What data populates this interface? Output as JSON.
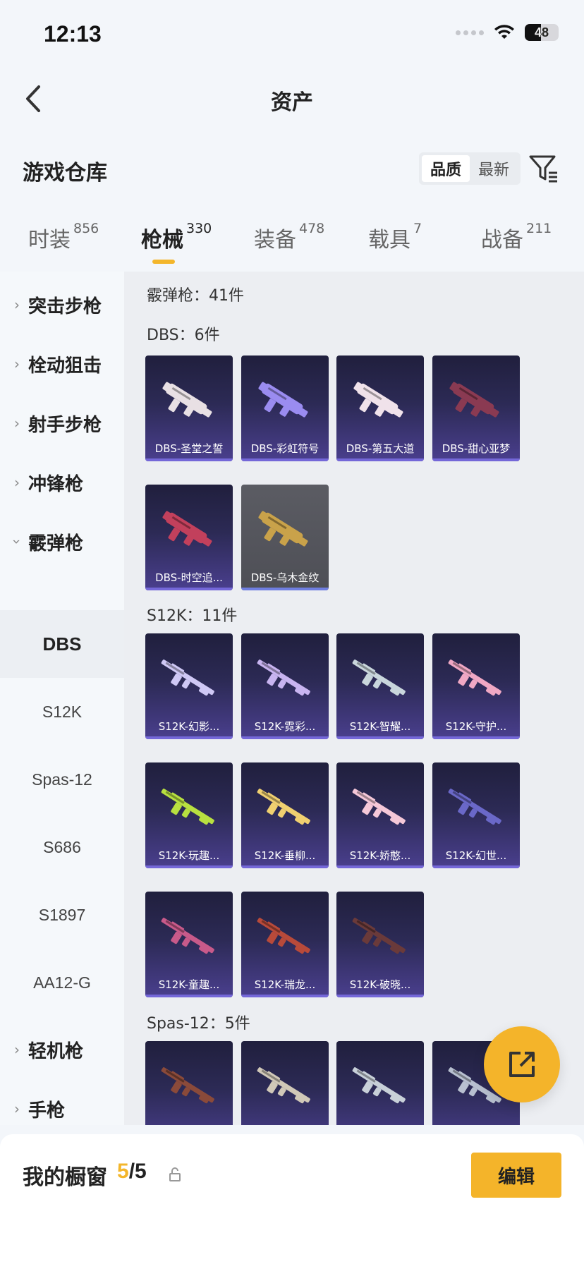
{
  "status": {
    "time": "12:13",
    "battery": "48",
    "battery_level": 0.48
  },
  "nav": {
    "title": "资产"
  },
  "warehouse": {
    "title": "游戏仓库",
    "sort_options": [
      "品质",
      "最新"
    ],
    "sort_active": "品质"
  },
  "tabs": [
    {
      "label": "时装",
      "count": "856"
    },
    {
      "label": "枪械",
      "count": "330"
    },
    {
      "label": "装备",
      "count": "478"
    },
    {
      "label": "载具",
      "count": "7"
    },
    {
      "label": "战备",
      "count": "211"
    }
  ],
  "sidebar": {
    "categories": [
      "突击步枪",
      "栓动狙击",
      "射手步枪",
      "冲锋枪",
      "霰弹枪"
    ],
    "subs": [
      "DBS",
      "S12K",
      "Spas-12",
      "S686",
      "S1897",
      "AA12-G"
    ],
    "bottom_categories": [
      "轻机枪",
      "手枪"
    ]
  },
  "content": {
    "category_title": "霰弹枪：41件",
    "groups": [
      {
        "title": "DBS：6件",
        "items": [
          "DBS-圣堂之誓",
          "DBS-彩虹符号",
          "DBS-第五大道",
          "DBS-甜心亚梦",
          "DBS-时空追...",
          "DBS-乌木金纹"
        ]
      },
      {
        "title": "S12K：11件",
        "items": [
          "S12K-幻影...",
          "S12K-霓彩...",
          "S12K-智耀...",
          "S12K-守护...",
          "S12K-玩趣...",
          "S12K-垂柳...",
          "S12K-娇憨...",
          "S12K-幻世...",
          "S12K-童趣...",
          "S12K-瑞龙...",
          "S12K-破晓..."
        ]
      },
      {
        "title": "Spas-12：5件",
        "items": [
          "",
          "",
          "",
          ""
        ]
      }
    ],
    "weapon_colors": {
      "dbs": [
        "#e8e0e4",
        "#9a8cf0",
        "#f0e2ea",
        "#8a3a52",
        "#c2405c",
        "#c9a24a"
      ],
      "s12k": [
        "#cfc8f5",
        "#c8b4f0",
        "#c9d6dc",
        "#f0a8c4",
        "#b8e040",
        "#f0d070",
        "#f5c8d8",
        "#6a68c8",
        "#c85a8a",
        "#b84a3a",
        "#6a3a3a"
      ],
      "spas": [
        "#8a4a3a",
        "#d0c8b8",
        "#c8d0d8",
        "#b8c0d0"
      ]
    }
  },
  "bottom": {
    "label": "我的橱窗",
    "current": "5",
    "total": "/5",
    "edit": "编辑"
  }
}
